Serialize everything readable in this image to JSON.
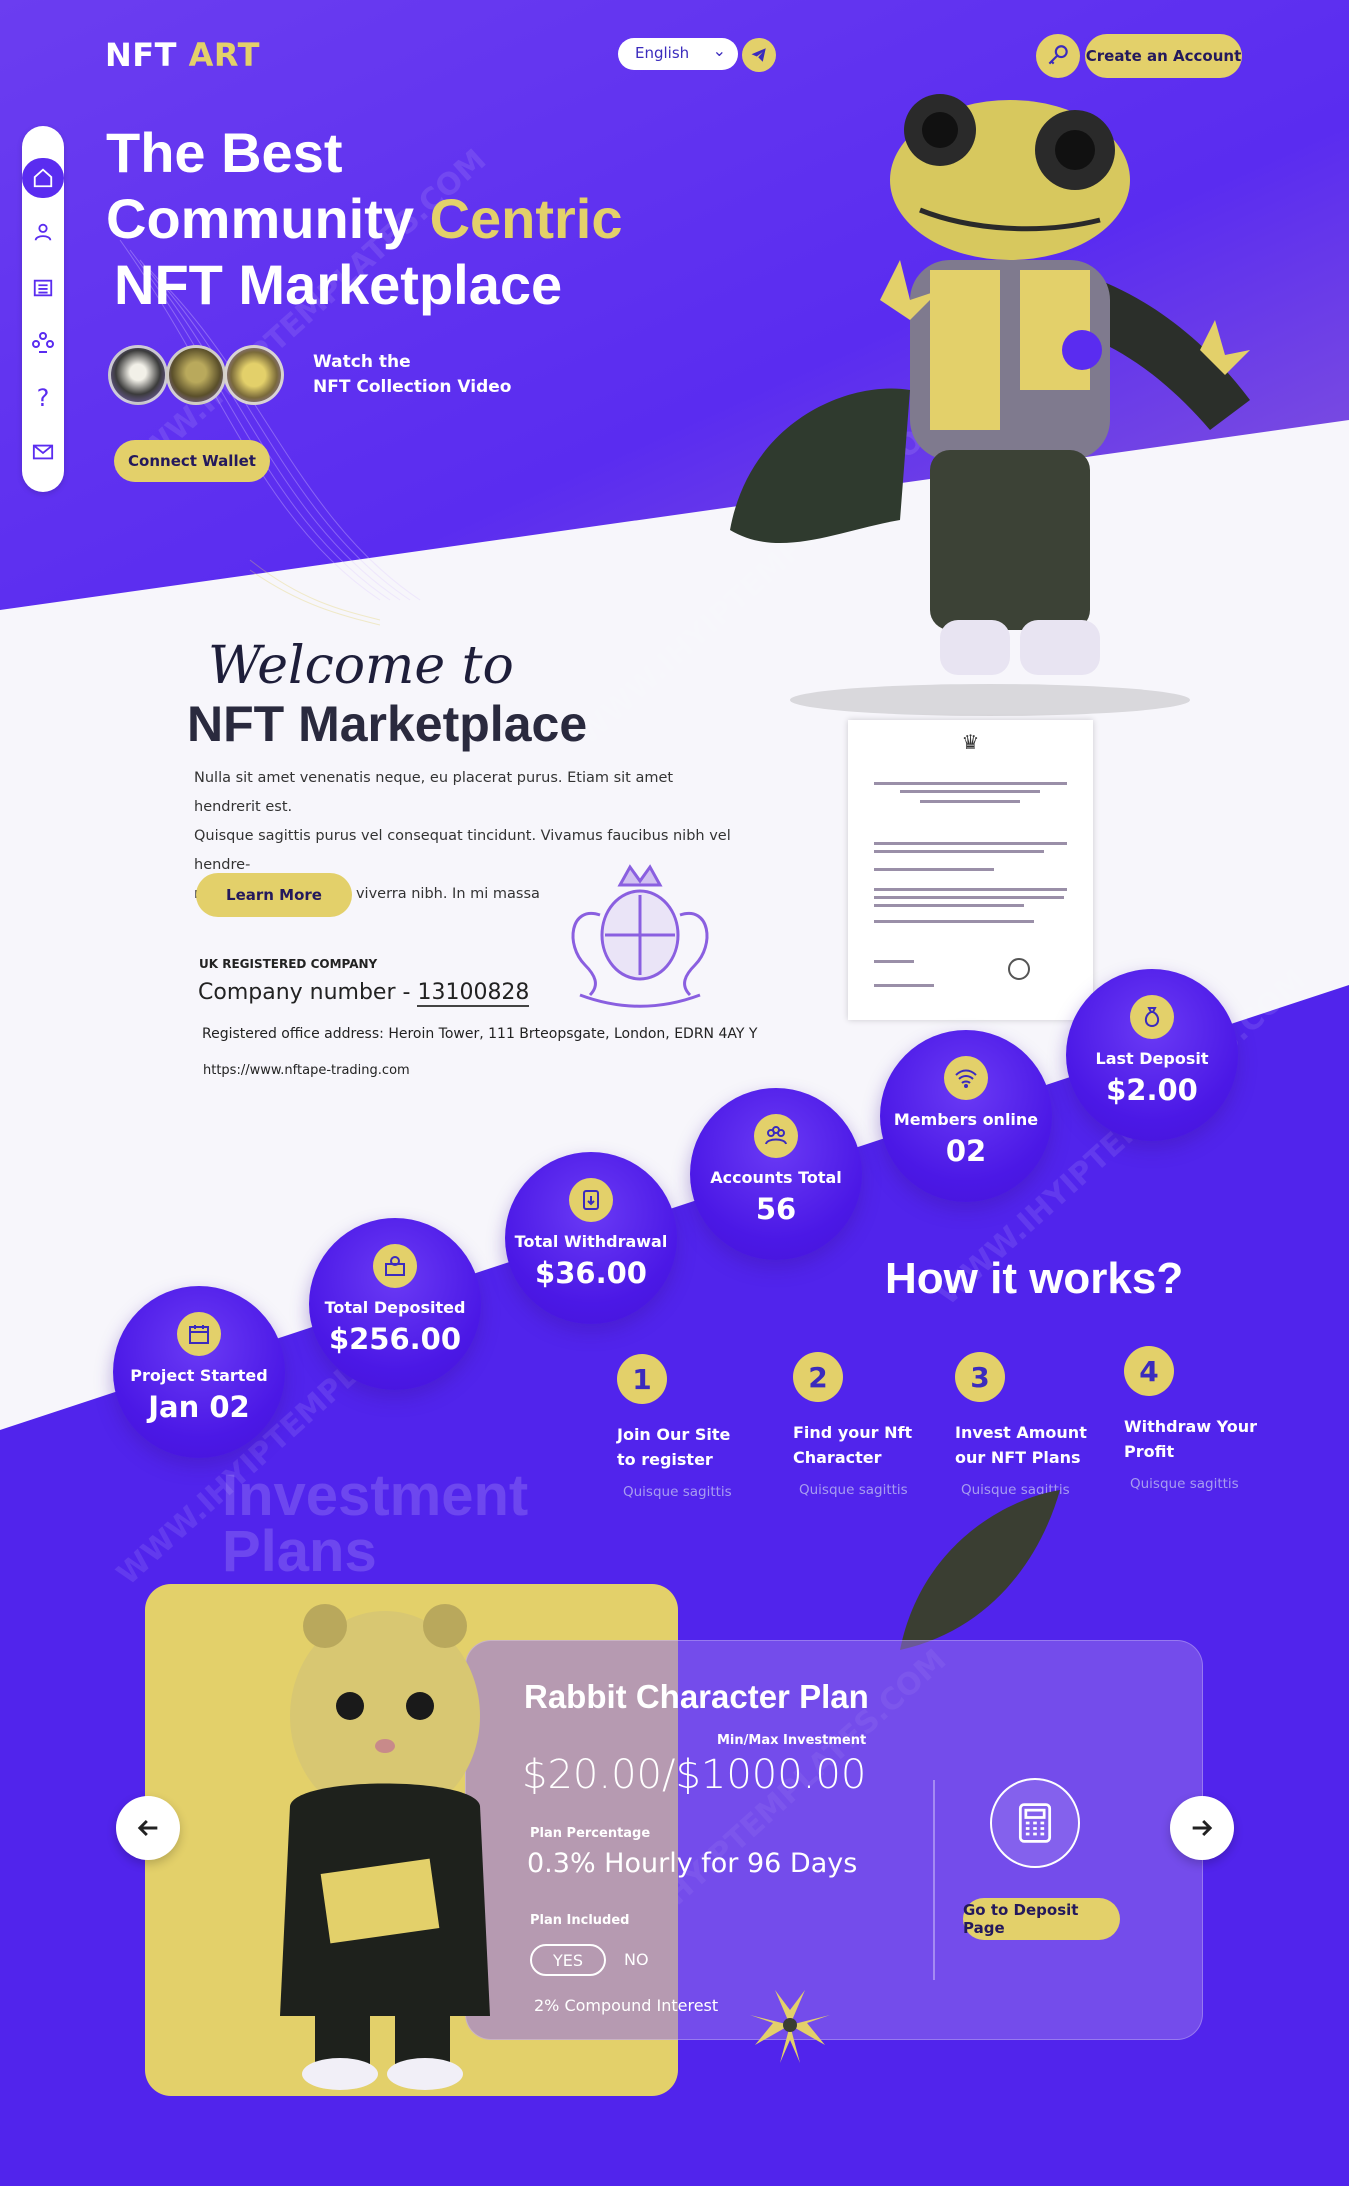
{
  "brand": {
    "logo_main": "NFT",
    "logo_accent": "ART"
  },
  "header": {
    "language": "English",
    "create_account": "Create an Account"
  },
  "sidenav": {
    "items": [
      "home-icon",
      "user-icon",
      "list-icon",
      "team-icon",
      "help-icon",
      "mail-icon"
    ]
  },
  "hero": {
    "title_line1": "The Best",
    "title_line2_a": "Community",
    "title_line2_b": "Centric",
    "title_line3": "NFT Marketplace",
    "watch_line1": "Watch the",
    "watch_line2": "NFT Collection Video",
    "connect_wallet": "Connect Wallet"
  },
  "welcome": {
    "script": "Welcome to",
    "heading": "NFT Marketplace",
    "para_line1": "Nulla sit amet venenatis neque, eu placerat purus. Etiam sit amet hendrerit est.",
    "para_line2": "Quisque sagittis purus vel consequat tincidunt. Vivamus faucibus nibh vel hendre-",
    "para_line3": "rit tempor. Donec sed viverra nibh. In mi massa",
    "learn_more": "Learn More",
    "uk_registered": "UK REGISTERED COMPANY",
    "company_number_label": "Company number -",
    "company_number": "13100828",
    "office": "Registered office address: Heroin Tower, 111 Brteopsgate, London, EDRN 4AY Y",
    "website": "https://www.nftape-trading.com"
  },
  "stats": [
    {
      "label": "Project Started",
      "value": "Jan 02",
      "icon": "calendar-icon"
    },
    {
      "label": "Total Deposited",
      "value": "$256.00",
      "icon": "deposit-icon"
    },
    {
      "label": "Total Withdrawal",
      "value": "$36.00",
      "icon": "withdraw-icon"
    },
    {
      "label": "Accounts Total",
      "value": "56",
      "icon": "accounts-icon"
    },
    {
      "label": "Members online",
      "value": "02",
      "icon": "wifi-icon"
    },
    {
      "label": "Last Deposit",
      "value": "$2.00",
      "icon": "money-bag-icon"
    }
  ],
  "how": {
    "title": "How it works?",
    "steps": [
      {
        "num": "1",
        "title_l1": "Join Our Site",
        "title_l2": "to register",
        "desc": "Quisque sagittis"
      },
      {
        "num": "2",
        "title_l1": "Find your Nft",
        "title_l2": "Character",
        "desc": "Quisque sagittis"
      },
      {
        "num": "3",
        "title_l1": "Invest Amount",
        "title_l2": "our NFT Plans",
        "desc": "Quisque sagittis"
      },
      {
        "num": "4",
        "title_l1": "Withdraw Your",
        "title_l2": "Profit",
        "desc": "Quisque sagittis"
      }
    ]
  },
  "plans": {
    "ghost_l1": "Investment",
    "ghost_l2": "Plans",
    "name": "Rabbit Character Plan",
    "minmax_label": "Min/Max Investment",
    "minmax_value": "$20.00/$1000.00",
    "percentage_label": "Plan Percentage",
    "percentage_value": "0.3% Hourly for 96 Days",
    "included_label": "Plan Included",
    "yes": "YES",
    "no": "NO",
    "compound": "2% Compound Interest",
    "deposit_button": "Go to Deposit Page"
  },
  "colors": {
    "purple": "#5a2cf0",
    "gold": "#e3d06a",
    "navy": "#24195c"
  }
}
